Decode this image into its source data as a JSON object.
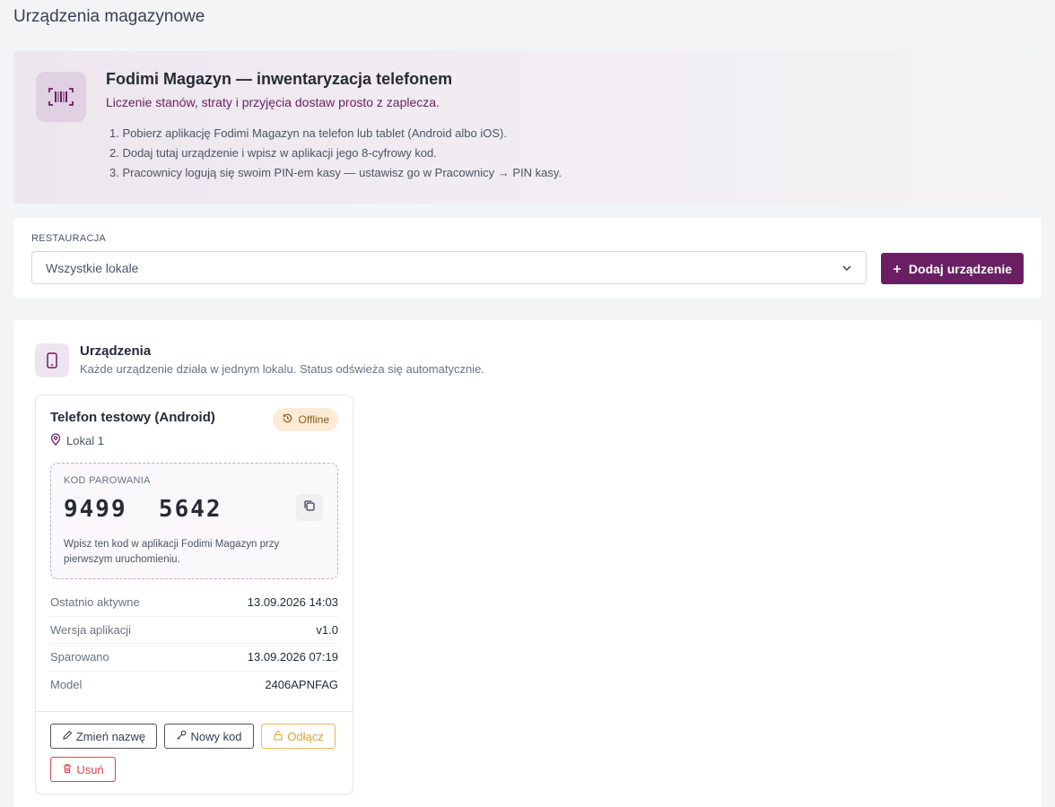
{
  "page": {
    "title": "Urządzenia magazynowe"
  },
  "intro": {
    "title": "Fodimi Magazyn — inwentaryzacja telefonem",
    "subtitle": "Liczenie stanów, straty i przyjęcia dostaw prosto z zaplecza.",
    "steps": [
      "1. Pobierz aplikację Fodimi Magazyn na telefon lub tablet (Android albo iOS).",
      "2. Dodaj tutaj urządzenie i wpisz w aplikacji jego 8-cyfrowy kod.",
      "3. Pracownicy logują się swoim PIN-em kasy — ustawisz go w Pracownicy → PIN kasy."
    ],
    "icon": "barcode-scan-icon"
  },
  "filter": {
    "label": "RESTAURACJA",
    "selected": "Wszystkie lokale",
    "add_button": "Dodaj urządzenie"
  },
  "devices_section": {
    "title": "Urządzenia",
    "subtitle": "Każde urządzenie działa w jednym lokalu. Status odświeża się automatycznie."
  },
  "device": {
    "name": "Telefon testowy (Android)",
    "status": "Offline",
    "location": "Lokal 1",
    "code_label": "KOD PAROWANIA",
    "code": "9499  5642",
    "code_hint": "Wpisz ten kod w aplikacji Fodimi Magazyn przy pierwszym uruchomieniu.",
    "info": [
      {
        "key": "Ostatnio aktywne",
        "value": "13.09.2026 14:03"
      },
      {
        "key": "Wersja aplikacji",
        "value": "v1.0"
      },
      {
        "key": "Sparowano",
        "value": "13.09.2026 07:19"
      },
      {
        "key": "Model",
        "value": "2406APNFAG"
      }
    ],
    "actions": {
      "rename": "Zmień nazwę",
      "new_code": "Nowy kod",
      "disconnect": "Odłącz",
      "delete": "Usuń"
    }
  },
  "colors": {
    "brand": "#6b1f63",
    "warning": "#e0a030",
    "danger": "#d9454f",
    "offline_badge_bg": "#fdebd5"
  }
}
